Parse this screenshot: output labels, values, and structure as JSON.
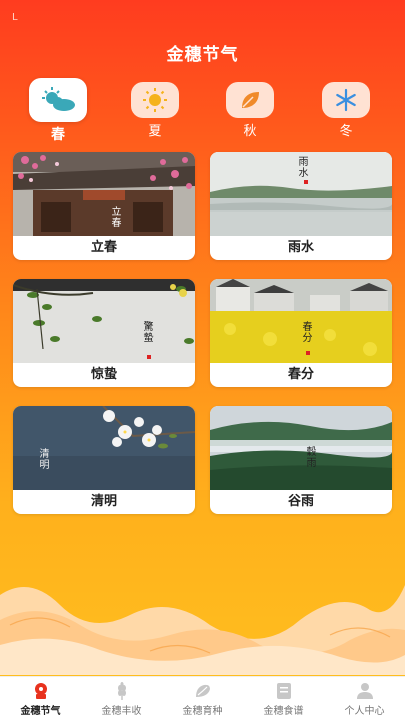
{
  "header": {
    "status_mark": "L",
    "title": "金穗节气"
  },
  "seasons": [
    {
      "label": "春",
      "icon": "sun-cloud-icon",
      "active": true
    },
    {
      "label": "夏",
      "icon": "sun-icon",
      "active": false
    },
    {
      "label": "秋",
      "icon": "leaf-icon",
      "active": false
    },
    {
      "label": "冬",
      "icon": "snowflake-icon",
      "active": false
    }
  ],
  "terms": [
    {
      "name": "立春",
      "caption": "立春"
    },
    {
      "name": "雨水",
      "caption": "雨水"
    },
    {
      "name": "惊蛰",
      "caption": "驚蟄"
    },
    {
      "name": "春分",
      "caption": "春分"
    },
    {
      "name": "清明",
      "caption": "清明"
    },
    {
      "name": "谷雨",
      "caption": "穀雨"
    }
  ],
  "tabs": [
    {
      "label": "金穗节气",
      "icon": "calendar-flower-icon",
      "active": true
    },
    {
      "label": "金穗丰收",
      "icon": "wheat-icon",
      "active": false
    },
    {
      "label": "金穗育种",
      "icon": "seed-icon",
      "active": false
    },
    {
      "label": "金穗食谱",
      "icon": "book-icon",
      "active": false
    },
    {
      "label": "个人中心",
      "icon": "user-icon",
      "active": false
    }
  ],
  "colors": {
    "accent": "#ff3c1f",
    "gold": "#ffc21f",
    "tab_active": "#e8321e"
  }
}
